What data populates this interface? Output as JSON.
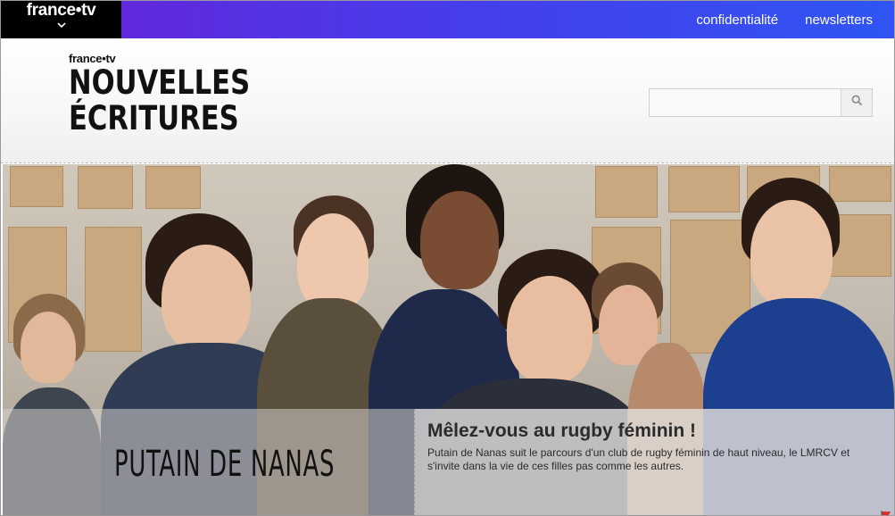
{
  "topbar": {
    "brand": "france•tv",
    "nav": [
      {
        "label": "confidentialité"
      },
      {
        "label": "newsletters"
      }
    ]
  },
  "header": {
    "logo": {
      "small": "france•tv",
      "line1": "NOUVELLES",
      "line2": "ÉCRITURES"
    },
    "search": {
      "placeholder": "",
      "value": ""
    }
  },
  "hero": {
    "show_title": "PUTAIN DE NANAS",
    "headline": "Mêlez-vous au rugby féminin !",
    "description": "Putain de Nanas suit le parcours d'un club de rugby féminin de haut niveau, le LMRCV et s'invite dans la vie de ces filles pas comme les autres."
  },
  "colors": {
    "topbar_start": "#6a22d6",
    "topbar_end": "#2f55f5",
    "brand_tab": "#000000"
  }
}
